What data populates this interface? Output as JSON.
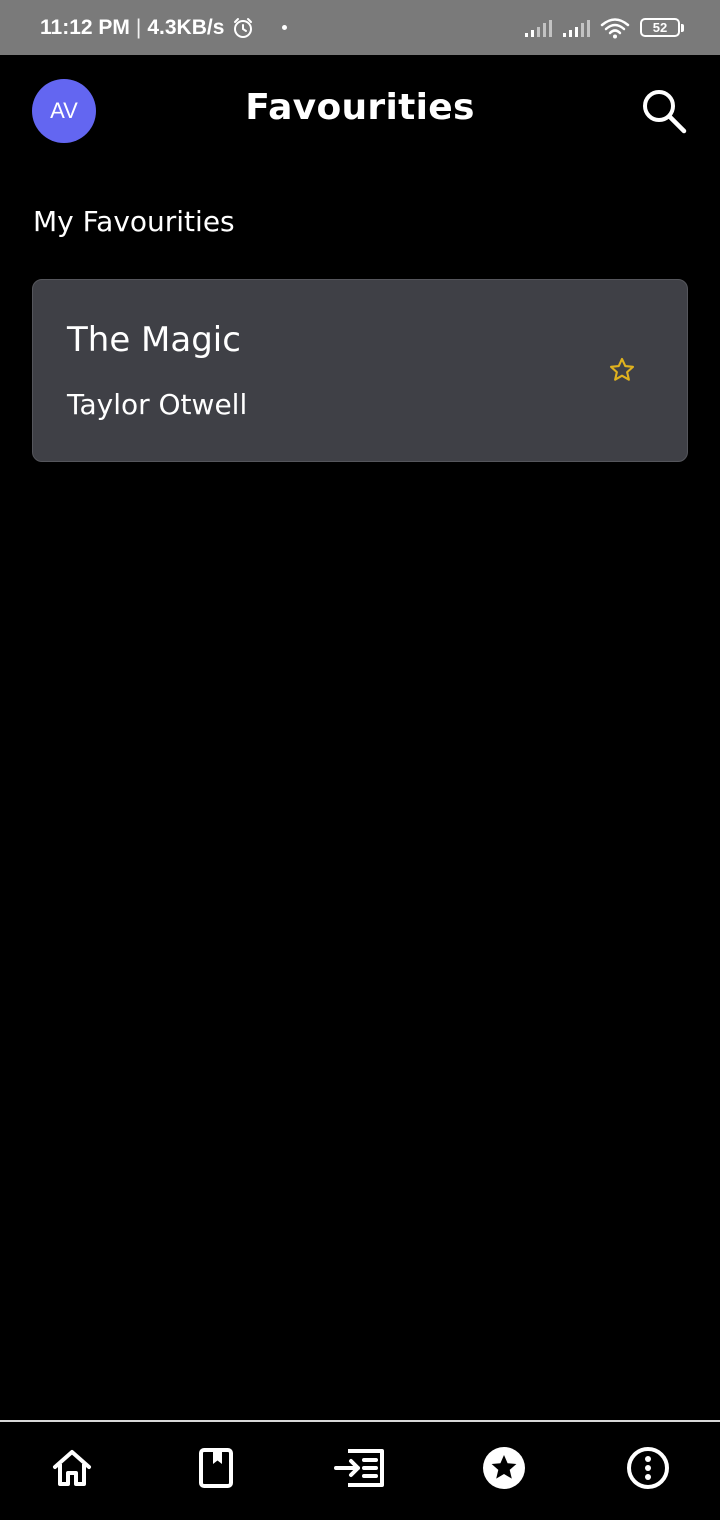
{
  "status_bar": {
    "time": "11:12 PM",
    "separator": "|",
    "network_speed": "4.3KB/s",
    "battery_level": "52",
    "icons": [
      "alarm-icon",
      "signal-icon",
      "signal-icon",
      "wifi-icon",
      "battery-icon"
    ]
  },
  "header": {
    "avatar_initials": "AV",
    "title": "Favourities",
    "search_icon": "search-icon"
  },
  "section": {
    "title": "My Favourities"
  },
  "favourites": [
    {
      "title": "The Magic",
      "author": "Taylor Otwell",
      "icon": "star-outline-icon"
    }
  ],
  "bottom_nav": {
    "items": [
      {
        "icon": "home-icon"
      },
      {
        "icon": "book-icon"
      },
      {
        "icon": "import-list-icon"
      },
      {
        "icon": "star-circle-icon"
      },
      {
        "icon": "more-info-icon"
      }
    ]
  },
  "colors": {
    "status_bar_bg": "#7a7a7a",
    "background": "#000000",
    "avatar_bg": "#6366f1",
    "card_bg": "#3f4046",
    "star_color": "#e0b21e"
  }
}
